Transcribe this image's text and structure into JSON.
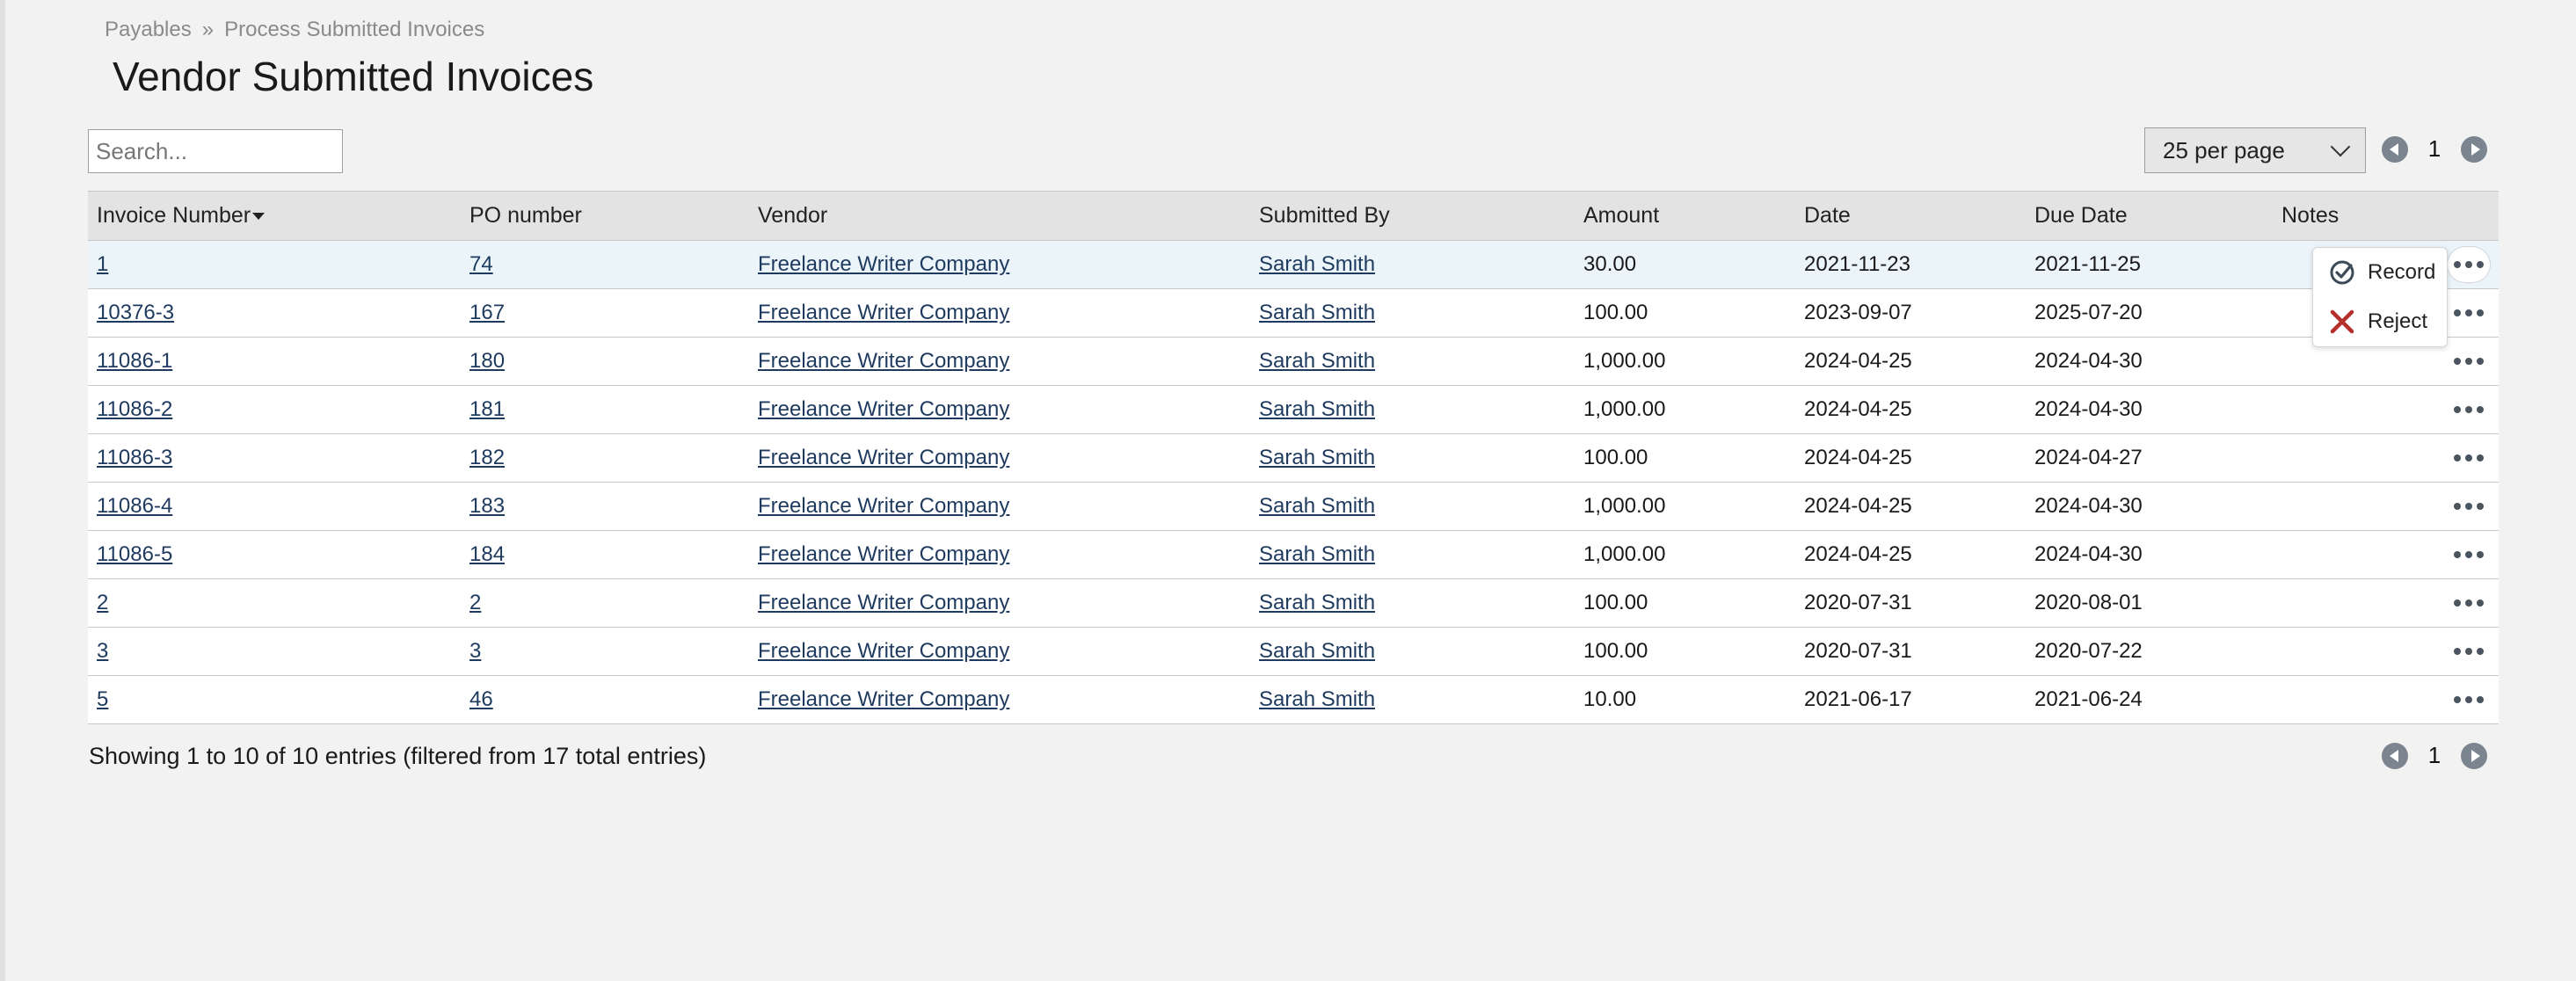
{
  "breadcrumb": {
    "items": [
      "Payables",
      "Process Submitted Invoices"
    ],
    "separator": "»"
  },
  "page": {
    "title": "Vendor Submitted Invoices"
  },
  "search": {
    "placeholder": "Search..."
  },
  "pagination": {
    "per_page": "25 per page",
    "current_page": "1"
  },
  "table": {
    "headers": [
      "Invoice Number",
      "PO number",
      "Vendor",
      "Submitted By",
      "Amount",
      "Date",
      "Due Date",
      "Notes"
    ],
    "rows": [
      [
        "1",
        "74",
        "Freelance Writer Company",
        "Sarah Smith",
        "30.00",
        "2021-11-23",
        "2021-11-25",
        ""
      ],
      [
        "10376-3",
        "167",
        "Freelance Writer Company",
        "Sarah Smith",
        "100.00",
        "2023-09-07",
        "2025-07-20",
        ""
      ],
      [
        "11086-1",
        "180",
        "Freelance Writer Company",
        "Sarah Smith",
        "1,000.00",
        "2024-04-25",
        "2024-04-30",
        ""
      ],
      [
        "11086-2",
        "181",
        "Freelance Writer Company",
        "Sarah Smith",
        "1,000.00",
        "2024-04-25",
        "2024-04-30",
        ""
      ],
      [
        "11086-3",
        "182",
        "Freelance Writer Company",
        "Sarah Smith",
        "100.00",
        "2024-04-25",
        "2024-04-27",
        ""
      ],
      [
        "11086-4",
        "183",
        "Freelance Writer Company",
        "Sarah Smith",
        "1,000.00",
        "2024-04-25",
        "2024-04-30",
        ""
      ],
      [
        "11086-5",
        "184",
        "Freelance Writer Company",
        "Sarah Smith",
        "1,000.00",
        "2024-04-25",
        "2024-04-30",
        ""
      ],
      [
        "2",
        "2",
        "Freelance Writer Company",
        "Sarah Smith",
        "100.00",
        "2020-07-31",
        "2020-08-01",
        ""
      ],
      [
        "3",
        "3",
        "Freelance Writer Company",
        "Sarah Smith",
        "100.00",
        "2020-07-31",
        "2020-07-22",
        ""
      ],
      [
        "5",
        "46",
        "Freelance Writer Company",
        "Sarah Smith",
        "10.00",
        "2021-06-17",
        "2021-06-24",
        ""
      ]
    ]
  },
  "action_menu": {
    "record_label": "Record",
    "reject_label": "Reject"
  },
  "summary": {
    "text": "Showing 1 to 10 of 10 entries (filtered from 17 total entries)"
  },
  "colors": {
    "link": "#1e3a5f",
    "active_row": "#eaf4f9",
    "reject_icon": "#b5302c",
    "pager_button": "#7a8590"
  }
}
